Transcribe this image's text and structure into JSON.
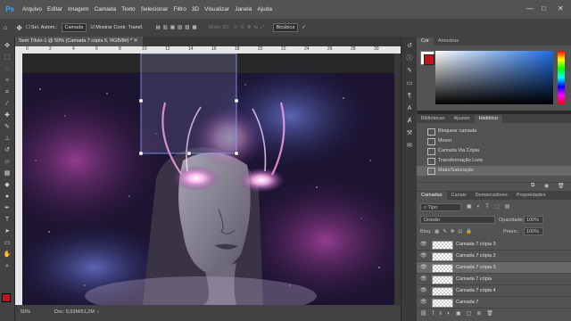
{
  "menu": [
    "Arquivo",
    "Editar",
    "Imagem",
    "Camada",
    "Texto",
    "Selecionar",
    "Filtro",
    "3D",
    "Visualizar",
    "Janela",
    "Ajuda"
  ],
  "app_logo": "Ps",
  "window_controls": [
    "—",
    "□",
    "✕"
  ],
  "options": {
    "auto_select": "Sel. Autom.:",
    "auto_select_target": "Camada",
    "show_transform": "Mostrar Contr. Transf.",
    "mode_3d": "Modo 3D:",
    "interp": "Bicúbica"
  },
  "document": {
    "tab_title": "Sem Título-1 @ 50% (Camada 7 cópia 5, RGB/8#) *",
    "zoom": "50%",
    "doc_size": "Doc: 5,93M/51,2M"
  },
  "ruler_numbers": [
    "0",
    "2",
    "4",
    "6",
    "8",
    "10",
    "12",
    "14",
    "16",
    "18",
    "20",
    "22",
    "24",
    "26",
    "28",
    "30"
  ],
  "color_panel": {
    "tabs": [
      "Cor",
      "Amostras"
    ],
    "foreground": "#c0141f",
    "background": "#ffffff"
  },
  "history_panel": {
    "tabs": [
      "Bibliotecas",
      "Ajustes",
      "Histórico"
    ],
    "items": [
      "Bloquear camada",
      "Mover",
      "Camada Via Cópia",
      "Transformação Livre",
      "Matiz/Saturação"
    ]
  },
  "layers_panel": {
    "tabs": [
      "Camadas",
      "Canais",
      "Demarcadores",
      "Propriedades"
    ],
    "filter_kind": "Tipo",
    "blend_mode": "Divisão",
    "opacity_label": "Opacidade:",
    "opacity_value": "100%",
    "lock_label": "Bloq.:",
    "fill_label": "Preen.:",
    "fill_value": "100%",
    "layers": [
      "Camada 7 cópia 3",
      "Camada 7 cópia 2",
      "Camada 7 cópia 5",
      "Camada 7 cópia",
      "Camada 7 cópia 4",
      "Camada 7"
    ]
  },
  "icons": {
    "tools": [
      "move-icon",
      "marquee-icon",
      "lasso-icon",
      "quick-select-icon",
      "crop-icon",
      "eyedropper-icon",
      "healing-icon",
      "brush-icon",
      "clone-stamp-icon",
      "history-brush-icon",
      "eraser-icon",
      "gradient-icon",
      "blur-icon",
      "dodge-icon",
      "pen-icon",
      "type-icon",
      "path-select-icon",
      "shape-icon",
      "hand-icon",
      "zoom-icon"
    ]
  }
}
